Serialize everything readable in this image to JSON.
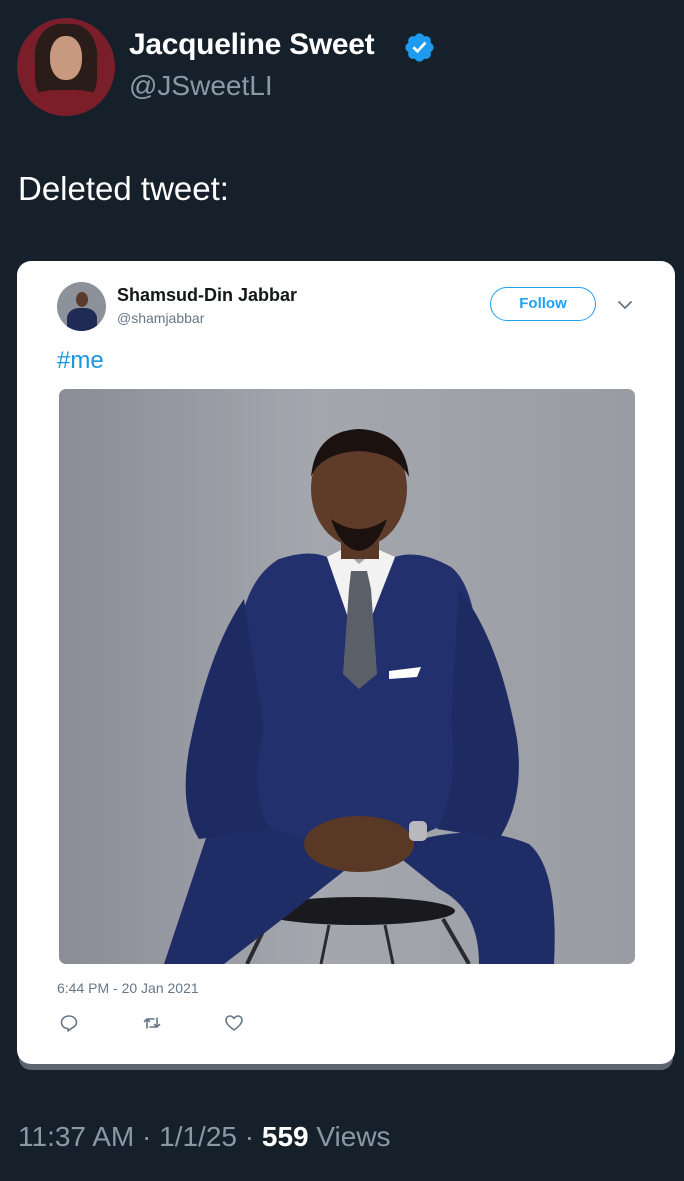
{
  "author": {
    "display_name": "Jacqueline Sweet",
    "handle": "@JSweetLI",
    "verified": true,
    "verified_color": "#1d9bf0"
  },
  "tweet": {
    "text": "Deleted tweet:"
  },
  "embedded": {
    "display_name": "Shamsud-Din Jabbar",
    "handle": "@shamjabbar",
    "follow_label": "Follow",
    "hashtag": "#me",
    "timestamp": "6:44 PM - 20 Jan 2021",
    "icons": [
      "reply-icon",
      "retweet-icon",
      "like-icon",
      "chevron-down-icon"
    ],
    "accent_color": "#1da1f2"
  },
  "meta": {
    "time": "11:37 AM",
    "separator": "·",
    "date": "1/1/25",
    "views_count": "559",
    "views_label": "Views"
  }
}
